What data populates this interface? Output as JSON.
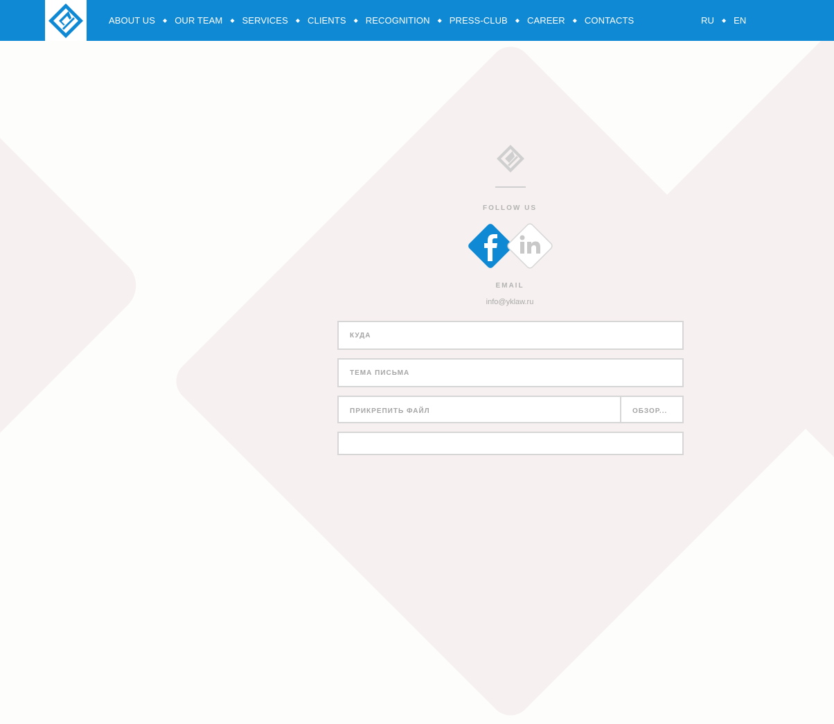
{
  "header": {
    "nav": [
      "ABOUT US",
      "OUR TEAM",
      "SERVICES",
      "CLIENTS",
      "RECOGNITION",
      "PRESS-CLUB",
      "CAREER",
      "CONTACTS"
    ],
    "active_item": "CONTACTS",
    "languages": [
      "RU",
      "EN"
    ]
  },
  "contacts": {
    "follow_label": "FOLLOW US",
    "social": [
      "facebook-icon",
      "linkedin-icon"
    ],
    "email_label": "EMAIL",
    "email_value": "info@yklaw.ru"
  },
  "form": {
    "to_placeholder": "КУДА",
    "subject_placeholder": "ТЕМА ПИСЬМА",
    "attach_label": "ПРИКРЕПИТЬ ФАЙЛ",
    "browse_label": "ОБЗОР..."
  },
  "colors": {
    "brand_blue": "#0f89d4",
    "background": "#fdfdfc",
    "shape": "#f6f1f0"
  }
}
